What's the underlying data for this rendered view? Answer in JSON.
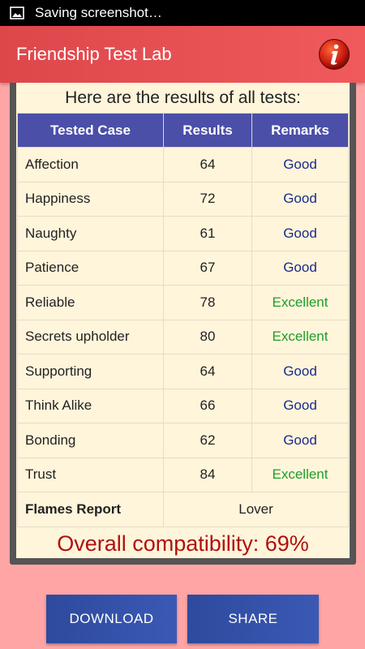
{
  "status_bar": {
    "text": "Saving screenshot…"
  },
  "app_bar": {
    "title": "Friendship Test Lab",
    "info_icon": "info-icon"
  },
  "results": {
    "heading": "Here are the results of all tests:",
    "columns": [
      "Tested Case",
      "Results",
      "Remarks"
    ],
    "rows": [
      {
        "case": "Affection",
        "score": "64",
        "remark": "Good",
        "level": "good"
      },
      {
        "case": "Happiness",
        "score": "72",
        "remark": "Good",
        "level": "good"
      },
      {
        "case": "Naughty",
        "score": "61",
        "remark": "Good",
        "level": "good"
      },
      {
        "case": "Patience",
        "score": "67",
        "remark": "Good",
        "level": "good"
      },
      {
        "case": "Reliable",
        "score": "78",
        "remark": "Excellent",
        "level": "excellent"
      },
      {
        "case": "Secrets upholder",
        "score": "80",
        "remark": "Excellent",
        "level": "excellent"
      },
      {
        "case": "Supporting",
        "score": "64",
        "remark": "Good",
        "level": "good"
      },
      {
        "case": "Think Alike",
        "score": "66",
        "remark": "Good",
        "level": "good"
      },
      {
        "case": "Bonding",
        "score": "62",
        "remark": "Good",
        "level": "good"
      },
      {
        "case": "Trust",
        "score": "84",
        "remark": "Excellent",
        "level": "excellent"
      }
    ],
    "flames_label": "Flames Report",
    "flames_value": "Lover",
    "overall": "Overall compatibility: 69%"
  },
  "buttons": {
    "download": "DOWNLOAD",
    "share": "SHARE"
  },
  "colors": {
    "background": "#ffa5a5",
    "app_bar": "#e8505a",
    "table_header": "#4b4fa8",
    "good": "#1b2a8e",
    "excellent": "#1f9d26",
    "overall": "#b0110f",
    "button": "#3351a8"
  }
}
